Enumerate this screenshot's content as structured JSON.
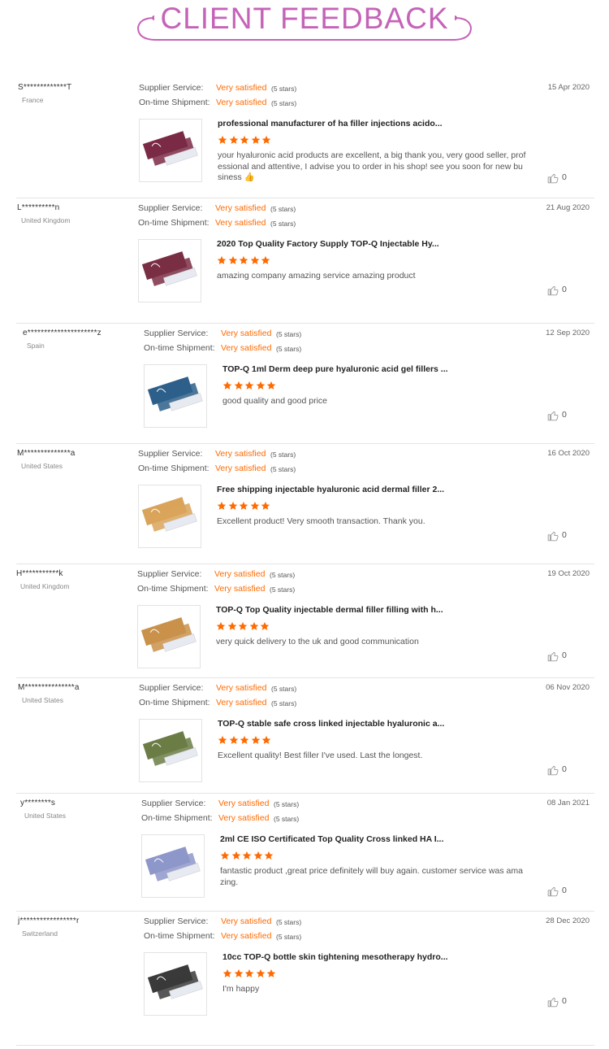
{
  "header": {
    "title_part1": "CLIENT",
    "title_part2": "FEEDBACK"
  },
  "labels": {
    "supplier_service": "Supplier Service:",
    "ontime_shipment": "On-time Shipment:"
  },
  "reviews": [
    {
      "user": "S*************T",
      "country": "France",
      "date": "15 Apr 2020",
      "supplier_rating": "Very satisfied",
      "supplier_stars": "(5 stars)",
      "shipment_rating": "Very satisfied",
      "shipment_stars": "(5 stars)",
      "product_title": "professional manufacturer of ha filler injections acido...",
      "rating": 5,
      "comment": "your hyaluronic acid products are excellent, a big thank you, very good seller, prof essional and attentive, I advise you to order in his shop!  see you soon for new bu siness 👍",
      "likes": "0",
      "thumb_color": "#7b2a45"
    },
    {
      "user": "L**********n",
      "country": "United Kingdom",
      "date": "21 Aug 2020",
      "supplier_rating": "Very satisfied",
      "supplier_stars": "(5 stars)",
      "shipment_rating": "Very satisfied",
      "shipment_stars": "(5 stars)",
      "product_title": "2020 Top Quality Factory Supply TOP-Q Injectable Hy...",
      "rating": 5,
      "comment": "amazing company amazing service amazing product",
      "likes": "0",
      "thumb_color": "#7a2e44"
    },
    {
      "user": "e*********************z",
      "country": "Spain",
      "date": "12 Sep 2020",
      "supplier_rating": "Very satisfied",
      "supplier_stars": "(5 stars)",
      "shipment_rating": "Very satisfied",
      "shipment_stars": "(5 stars)",
      "product_title": "TOP-Q 1ml Derm deep pure hyaluronic acid gel fillers ...",
      "rating": 5,
      "comment": "good quality and good price",
      "likes": "0",
      "thumb_color": "#2d5f8a"
    },
    {
      "user": "M**************a",
      "country": "United States",
      "date": "16 Oct 2020",
      "supplier_rating": "Very satisfied",
      "supplier_stars": "(5 stars)",
      "shipment_rating": "Very satisfied",
      "shipment_stars": "(5 stars)",
      "product_title": "Free shipping injectable hyaluronic acid dermal filler 2...",
      "rating": 5,
      "comment": "Excellent product! Very smooth transaction. Thank you.",
      "likes": "0",
      "thumb_color": "#d9a45a"
    },
    {
      "user": "H***********k",
      "country": "United Kingdom",
      "date": "19 Oct 2020",
      "supplier_rating": "Very satisfied",
      "supplier_stars": "(5 stars)",
      "shipment_rating": "Very satisfied",
      "shipment_stars": "(5 stars)",
      "product_title": "TOP-Q Top Quality injectable dermal filler filling with h...",
      "rating": 5,
      "comment": "very quick delivery to the uk and good communication",
      "likes": "0",
      "thumb_color": "#c9914a"
    },
    {
      "user": "M***************a",
      "country": "United States",
      "date": "06 Nov 2020",
      "supplier_rating": "Very satisfied",
      "supplier_stars": "(5 stars)",
      "shipment_rating": "Very satisfied",
      "shipment_stars": "(5 stars)",
      "product_title": "TOP-Q stable safe cross linked injectable hyaluronic a...",
      "rating": 5,
      "comment": "Excellent quality! Best filler I've used. Last the longest.",
      "likes": "0",
      "thumb_color": "#6b7c45"
    },
    {
      "user": "y********s",
      "country": "United States",
      "date": "08 Jan 2021",
      "supplier_rating": "Very satisfied",
      "supplier_stars": "(5 stars)",
      "shipment_rating": "Very satisfied",
      "shipment_stars": "(5 stars)",
      "product_title": "2ml CE ISO Certificated Top Quality Cross linked HA I...",
      "rating": 5,
      "comment": "fantastic product ,great price definitely will buy again. customer service was ama zing.",
      "likes": "0",
      "thumb_color": "#8e97c9"
    },
    {
      "user": "j*****************r",
      "country": "Switzerland",
      "date": "28 Dec 2020",
      "supplier_rating": "Very satisfied",
      "supplier_stars": "(5 stars)",
      "shipment_rating": "Very satisfied",
      "shipment_stars": "(5 stars)",
      "product_title": "10cc TOP-Q bottle skin tightening mesotherapy hydro...",
      "rating": 5,
      "comment": "I'm happy",
      "likes": "0",
      "thumb_color": "#3a3a3a"
    }
  ],
  "colors": {
    "accent": "#ff6a00",
    "title": "#c563b8",
    "star": "#ff6a00"
  }
}
